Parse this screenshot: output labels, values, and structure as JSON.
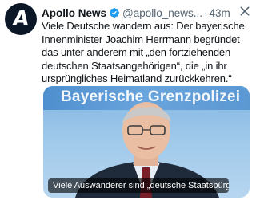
{
  "author": {
    "name": "Apollo News",
    "handle": "@apollo_news...",
    "avatar_letter": "A",
    "verified_color": "#1d9bf0"
  },
  "timestamp": "43m",
  "separator": "·",
  "text_lines": [
    "Viele Deutsche wandern aus: Der bayerische",
    "Innenminister Joachim Herrmann begründet",
    "das unter anderem mit „den fortziehenden",
    "deutschen Staatsangehörigen“, die „in ihr",
    "ursprüngliches Heimatland zurückkehren.“"
  ],
  "media": {
    "banner_text": "Bayerische Grenzpolizei",
    "caption": "Viele Auswanderer sind „deutsche Staatsbürger“..."
  },
  "icons": {
    "verified": "verified-badge-icon",
    "close": "close-icon"
  }
}
